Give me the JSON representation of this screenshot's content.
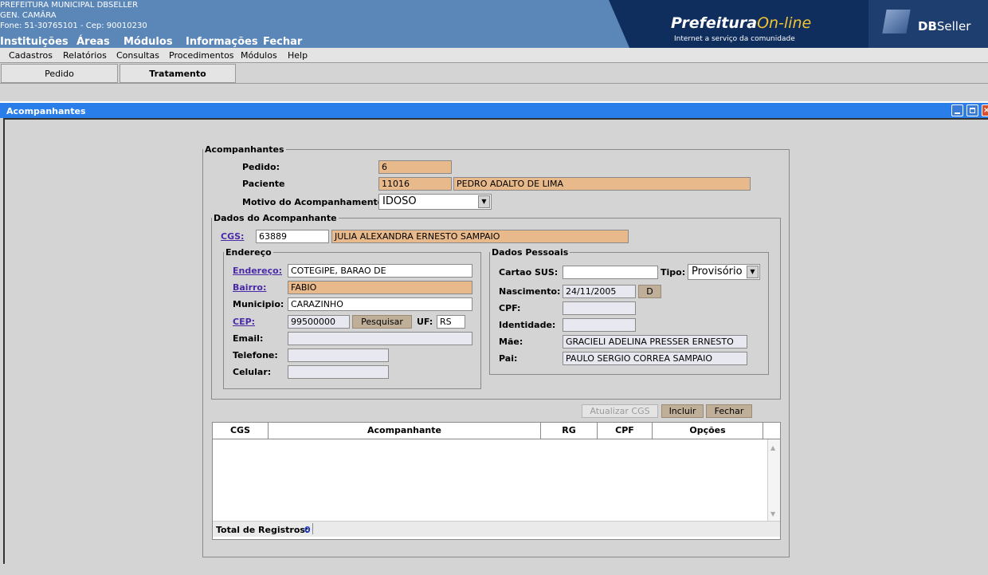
{
  "header": {
    "org_name": "PREFEITURA MUNICIPAL DBSELLER",
    "dept": "GEN. CAMÂRA",
    "contact": "Fone: 51-30765101  -  Cep: 90010230",
    "top_menu": [
      "Instituições",
      "Áreas",
      "Módulos",
      "Informações",
      "Fechar"
    ],
    "brand_prefeitura": "Prefeitura",
    "brand_online": "On-line",
    "brand_tagline": "Internet a serviço da comunidade",
    "dbseller_db": "DB",
    "dbseller_seller": "Seller"
  },
  "menubar": [
    "Cadastros",
    "Relatórios",
    "Consultas",
    "Procedimentos",
    "Módulos",
    "Help"
  ],
  "tabs": [
    "Pedido",
    "Tratamento"
  ],
  "window": {
    "title": "Acompanhantes"
  },
  "form": {
    "legend": "Acompanhantes",
    "pedido_label": "Pedido:",
    "pedido_value": "6",
    "paciente_label": "Paciente",
    "paciente_code": "11016",
    "paciente_name": "PEDRO ADALTO DE LIMA",
    "motivo_label": "Motivo do Acompanhamento:",
    "motivo_value": "IDOSO"
  },
  "dados": {
    "legend": "Dados do Acompanhante",
    "cgs_label": "CGS:",
    "cgs_value": "63889",
    "cgs_name": "JULIA ALEXANDRA ERNESTO SAMPAIO"
  },
  "endereco": {
    "legend": "Endereço",
    "endereco_label": "Endereço:",
    "endereco_value": "COTEGIPE, BARAO DE",
    "bairro_label": "Bairro:",
    "bairro_value": "FABIO",
    "municipio_label": "Municipio:",
    "municipio_value": "CARAZINHO",
    "cep_label": "CEP:",
    "cep_value": "99500000",
    "pesquisar": "Pesquisar",
    "uf_label": "UF:",
    "uf_value": "RS",
    "email_label": "Email:",
    "email_value": "",
    "telefone_label": "Telefone:",
    "telefone_value": "",
    "celular_label": "Celular:",
    "celular_value": ""
  },
  "pessoais": {
    "legend": "Dados Pessoais",
    "sus_label": "Cartao SUS:",
    "sus_value": "",
    "tipo_label": "Tipo:",
    "tipo_value": "Provisório",
    "nasc_label": "Nascimento:",
    "nasc_value": "24/11/2005",
    "nasc_btn": "D",
    "cpf_label": "CPF:",
    "cpf_value": "",
    "ident_label": "Identidade:",
    "ident_value": "",
    "mae_label": "Mãe:",
    "mae_value": "GRACIELI ADELINA PRESSER ERNESTO",
    "pai_label": "Pai:",
    "pai_value": "PAULO SERGIO CORREA SAMPAIO"
  },
  "actions": {
    "atualizar": "Atualizar CGS",
    "incluir": "Incluir",
    "fechar": "Fechar"
  },
  "table": {
    "columns": [
      "CGS",
      "Acompanhante",
      "RG",
      "CPF",
      "Opções"
    ],
    "rows": [],
    "total_label": "Total de Registros:",
    "total_value": "0"
  },
  "colors": {
    "header_blue": "#5b86b8",
    "title_bar": "#2a7eea",
    "readonly_field": "#e8b98a",
    "link": "#4b2aa8"
  }
}
